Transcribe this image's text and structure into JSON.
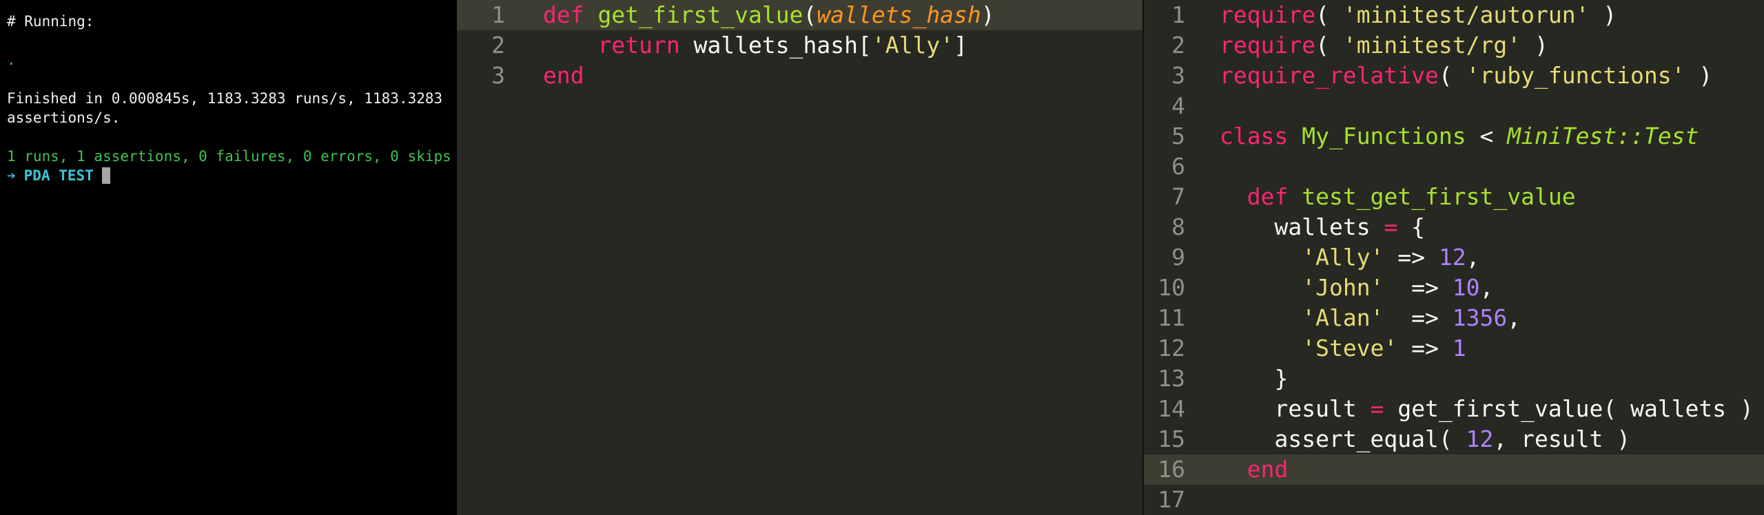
{
  "terminal": {
    "lines": {
      "running": "# Running:",
      "dot": ".",
      "finished": "Finished in 0.000845s, 1183.3283 runs/s, 1183.3283 assertions/s.",
      "summary": "1 runs, 1 assertions, 0 failures, 0 errors, 0 skips"
    },
    "prompt_arrow": "➔",
    "prompt_dir": "PDA TEST"
  },
  "left_editor": {
    "line_numbers": [
      "1",
      "2",
      "3"
    ],
    "code": {
      "l1_def": "def",
      "l1_fn": "get_first_value",
      "l1_open": "(",
      "l1_param": "wallets_hash",
      "l1_close": ")",
      "l2_return": "return",
      "l2_expr_a": " wallets_hash[",
      "l2_str": "'Ally'",
      "l2_expr_b": "]",
      "l3_end": "end"
    }
  },
  "right_editor": {
    "line_numbers": [
      "1",
      "2",
      "3",
      "4",
      "5",
      "6",
      "7",
      "8",
      "9",
      "10",
      "11",
      "12",
      "13",
      "14",
      "15",
      "16",
      "17"
    ],
    "code": {
      "l1_req": "require",
      "l1_open": "( ",
      "l1_str": "'minitest/autorun'",
      "l1_close": " )",
      "l2_req": "require",
      "l2_open": "( ",
      "l2_str": "'minitest/rg'",
      "l2_close": " )",
      "l3_req": "require_relative",
      "l3_open": "( ",
      "l3_str": "'ruby_functions'",
      "l3_close": " )",
      "l5_class": "class",
      "l5_name": "My_Functions",
      "l5_lt": " < ",
      "l5_parent": "MiniTest::Test",
      "l7_def": "def",
      "l7_fn": "test_get_first_value",
      "l8_var": "wallets",
      "l8_eq": "=",
      "l8_brace": " {",
      "l9_str": "'Ally'",
      "l9_arrow": " => ",
      "l9_num": "12",
      "l9_comma": ",",
      "l10_str": "'John'",
      "l10_arrow": "  => ",
      "l10_num": "10",
      "l10_comma": ",",
      "l11_str": "'Alan'",
      "l11_arrow": "  => ",
      "l11_num": "1356",
      "l11_comma": ",",
      "l12_str": "'Steve'",
      "l12_arrow": " => ",
      "l12_num": "1",
      "l13_brace": "}",
      "l14_var": "result",
      "l14_eq": "=",
      "l14_call": " get_first_value( wallets )",
      "l15_call": "assert_equal( ",
      "l15_num": "12",
      "l15_rest": ", result )",
      "l16_end": "end"
    }
  },
  "colors": {
    "editor_bg": "#272822",
    "keyword": "#f92672",
    "function": "#a6e22e",
    "string": "#e6db74",
    "number": "#ae81ff",
    "param": "#fd971f",
    "terminal_green": "#40c352",
    "prompt_cyan": "#3ac7d6"
  }
}
